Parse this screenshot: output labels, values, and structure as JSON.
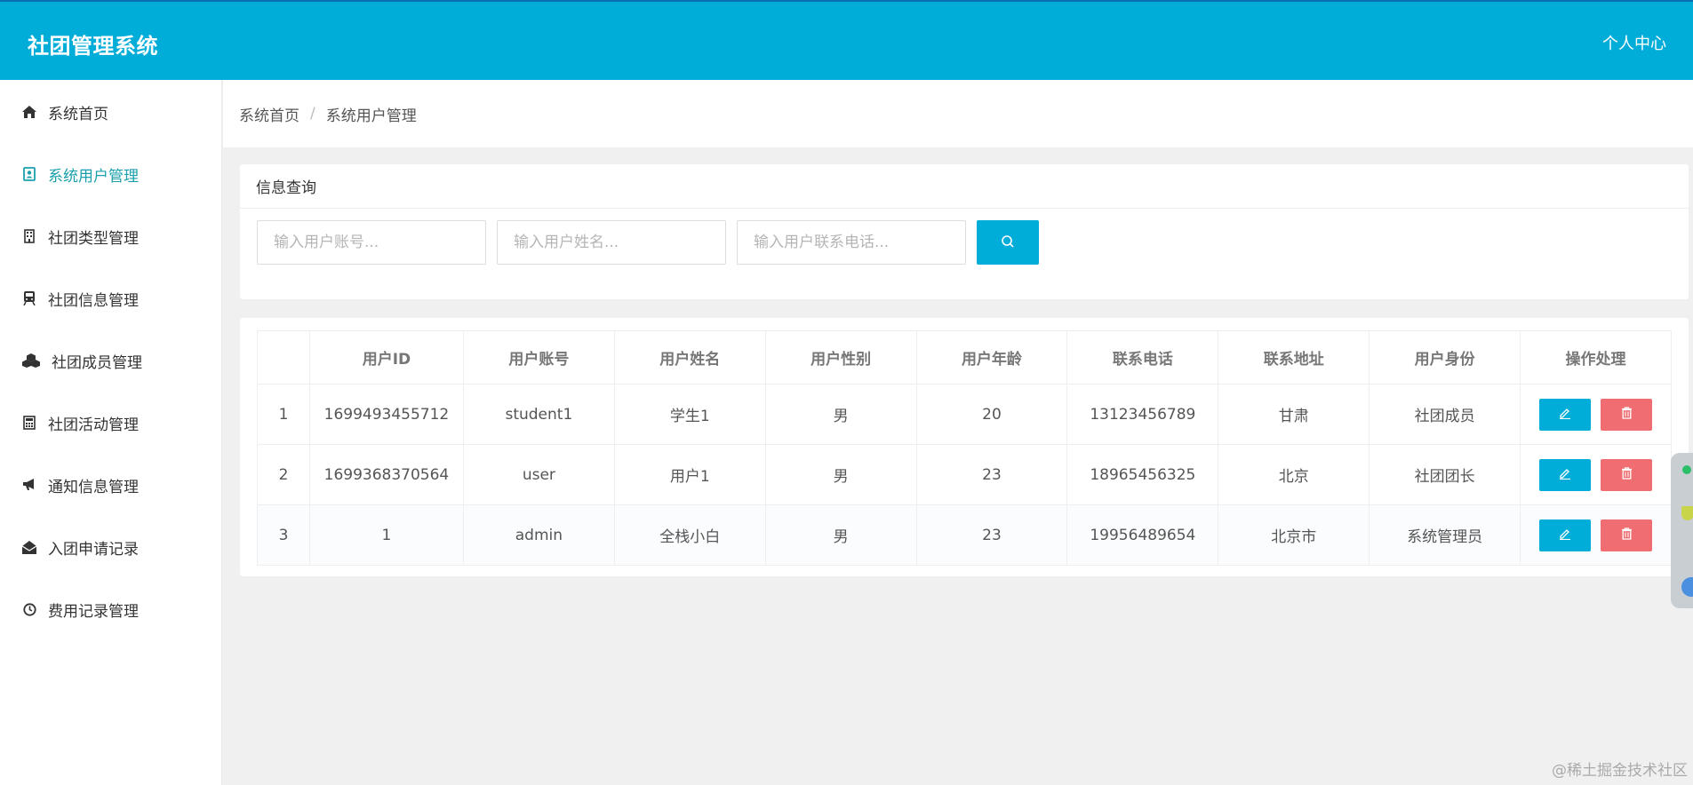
{
  "header": {
    "app_title": "社团管理系统",
    "user_center": "个人中心"
  },
  "sidebar": {
    "items": [
      {
        "label": "系统首页",
        "icon": "home-icon",
        "active": false
      },
      {
        "label": "系统用户管理",
        "icon": "user-card-icon",
        "active": true
      },
      {
        "label": "社团类型管理",
        "icon": "building-icon",
        "active": false
      },
      {
        "label": "社团信息管理",
        "icon": "train-icon",
        "active": false
      },
      {
        "label": "社团成员管理",
        "icon": "cubes-icon",
        "active": false
      },
      {
        "label": "社团活动管理",
        "icon": "calculator-icon",
        "active": false
      },
      {
        "label": "通知信息管理",
        "icon": "bullhorn-icon",
        "active": false
      },
      {
        "label": "入团申请记录",
        "icon": "envelope-open-icon",
        "active": false
      },
      {
        "label": "费用记录管理",
        "icon": "clock-icon",
        "active": false
      }
    ]
  },
  "breadcrumb": {
    "home": "系统首页",
    "separator": "/",
    "current": "系统用户管理"
  },
  "query": {
    "title": "信息查询",
    "account_placeholder": "输入用户账号...",
    "name_placeholder": "输入用户姓名...",
    "phone_placeholder": "输入用户联系电话...",
    "search_icon": "search-icon"
  },
  "table": {
    "headers": [
      "",
      "用户ID",
      "用户账号",
      "用户姓名",
      "用户性别",
      "用户年龄",
      "联系电话",
      "联系地址",
      "用户身份",
      "操作处理"
    ],
    "rows": [
      {
        "index": "1",
        "id": "1699493455712",
        "account": "student1",
        "name": "学生1",
        "gender": "男",
        "age": "20",
        "phone": "13123456789",
        "address": "甘肃",
        "role": "社团成员"
      },
      {
        "index": "2",
        "id": "1699368370564",
        "account": "user",
        "name": "用户1",
        "gender": "男",
        "age": "23",
        "phone": "18965456325",
        "address": "北京",
        "role": "社团团长"
      },
      {
        "index": "3",
        "id": "1",
        "account": "admin",
        "name": "全栈小白",
        "gender": "男",
        "age": "23",
        "phone": "19956489654",
        "address": "北京市",
        "role": "系统管理员"
      }
    ],
    "edit_icon": "edit-icon",
    "delete_icon": "trash-icon"
  },
  "colors": {
    "primary": "#00acd8",
    "danger": "#f06e72",
    "active_nav": "#1aa0ad"
  },
  "watermark": "@稀土掘金技术社区"
}
